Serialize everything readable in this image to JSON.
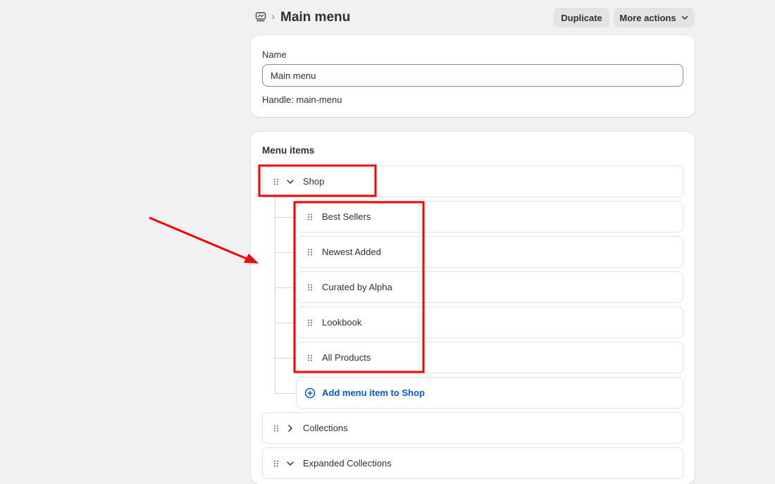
{
  "header": {
    "nav_icon": "navigation-icon",
    "breadcrumb_separator": "›",
    "title": "Main menu",
    "duplicate_label": "Duplicate",
    "more_actions_label": "More actions"
  },
  "name_card": {
    "name_label": "Name",
    "name_value": "Main menu",
    "handle_text": "Handle: main-menu"
  },
  "menu_items": {
    "title": "Menu items",
    "shop": {
      "label": "Shop",
      "children": [
        {
          "label": "Best Sellers"
        },
        {
          "label": "Newest Added"
        },
        {
          "label": "Curated by Alpha"
        },
        {
          "label": "Lookbook"
        },
        {
          "label": "All Products"
        }
      ],
      "add_label": "Add menu item to Shop"
    },
    "collections": {
      "label": "Collections"
    },
    "expanded_collections": {
      "label": "Expanded Collections"
    }
  },
  "colors": {
    "background": "#f1f1f1",
    "card": "#ffffff",
    "link": "#005bd3",
    "annotation": "#ff0000"
  }
}
